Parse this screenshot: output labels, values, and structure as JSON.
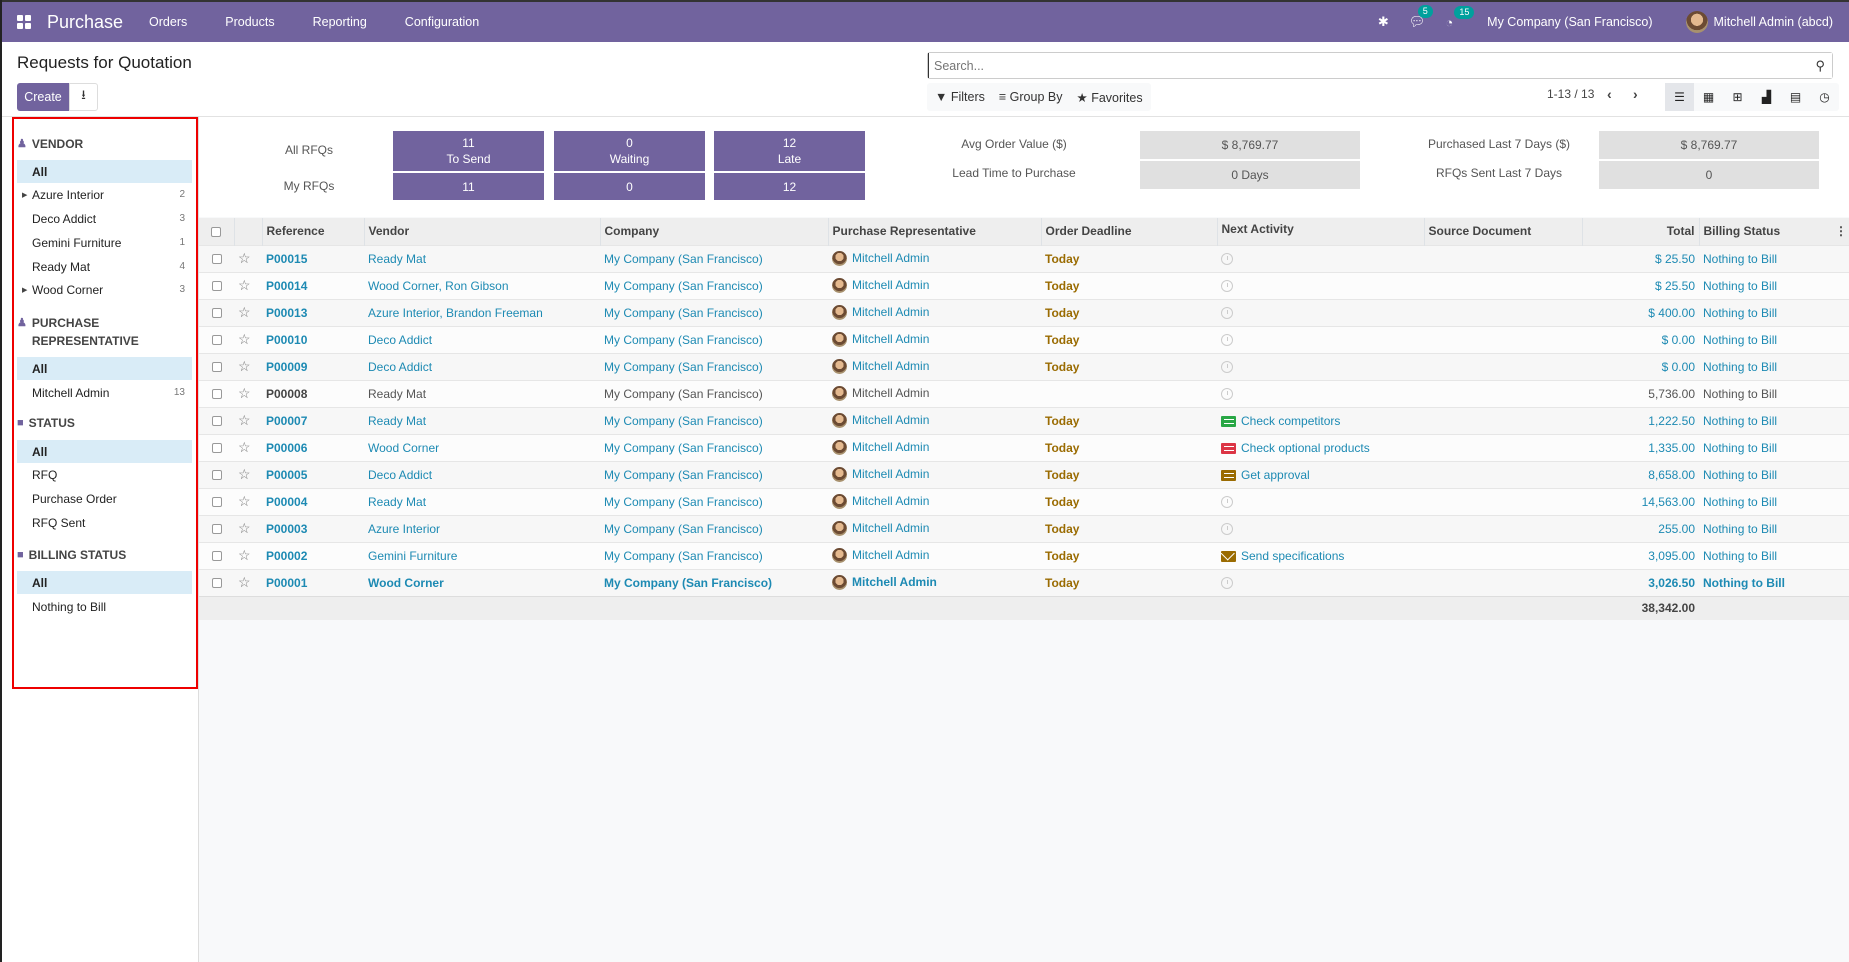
{
  "navbar": {
    "app_name": "Purchase",
    "menu": [
      "Orders",
      "Products",
      "Reporting",
      "Configuration"
    ],
    "messages_badge": "5",
    "activities_badge": "15",
    "company": "My Company (San Francisco)",
    "user": "Mitchell Admin (abcd)"
  },
  "control_panel": {
    "title": "Requests for Quotation",
    "create_label": "Create",
    "search_placeholder": "Search...",
    "filters_label": "Filters",
    "group_by_label": "Group By",
    "favorites_label": "Favorites",
    "pager": "1-13 / 13",
    "views": [
      "list",
      "kanban",
      "pivot",
      "graph",
      "calendar",
      "activity"
    ],
    "active_view": "list"
  },
  "sidebar": {
    "sections": [
      {
        "title": "VENDOR",
        "icon": "user-icon",
        "items": [
          {
            "label": "All",
            "count": "",
            "active": true,
            "expandable": false
          },
          {
            "label": "Azure Interior",
            "count": "2",
            "active": false,
            "expandable": true
          },
          {
            "label": "Deco Addict",
            "count": "3",
            "active": false,
            "expandable": false
          },
          {
            "label": "Gemini Furniture",
            "count": "1",
            "active": false,
            "expandable": false
          },
          {
            "label": "Ready Mat",
            "count": "4",
            "active": false,
            "expandable": false
          },
          {
            "label": "Wood Corner",
            "count": "3",
            "active": false,
            "expandable": true
          }
        ]
      },
      {
        "title": "PURCHASE REPRESENTATIVE",
        "icon": "user-icon",
        "items": [
          {
            "label": "All",
            "count": "",
            "active": true
          },
          {
            "label": "Mitchell Admin",
            "count": "13",
            "active": false
          }
        ]
      },
      {
        "title": "STATUS",
        "icon": "folder-icon",
        "items": [
          {
            "label": "All",
            "count": "",
            "active": true
          },
          {
            "label": "RFQ",
            "count": "",
            "active": false
          },
          {
            "label": "Purchase Order",
            "count": "",
            "active": false
          },
          {
            "label": "RFQ Sent",
            "count": "",
            "active": false
          }
        ]
      },
      {
        "title": "BILLING STATUS",
        "icon": "folder-icon",
        "items": [
          {
            "label": "All",
            "count": "",
            "active": true
          },
          {
            "label": "Nothing to Bill",
            "count": "",
            "active": false
          }
        ]
      }
    ]
  },
  "dashboard": {
    "row_labels": [
      "All RFQs",
      "My RFQs"
    ],
    "all": [
      {
        "value": "11",
        "label": "To Send"
      },
      {
        "value": "0",
        "label": "Waiting"
      },
      {
        "value": "12",
        "label": "Late"
      }
    ],
    "mine": [
      "11",
      "0",
      "12"
    ],
    "kpis": [
      {
        "label": "Avg Order Value ($)",
        "value": "$ 8,769.77"
      },
      {
        "label": "Lead Time to Purchase",
        "value": "0  Days"
      },
      {
        "label": "Purchased Last 7 Days ($)",
        "value": "$ 8,769.77"
      },
      {
        "label": "RFQs Sent Last 7 Days",
        "value": "0"
      }
    ]
  },
  "table": {
    "columns": [
      "Reference",
      "Vendor",
      "Company",
      "Purchase Representative",
      "Order Deadline",
      "Next Activity",
      "Source Document",
      "Total",
      "Billing Status"
    ],
    "rows": [
      {
        "ref": "P00015",
        "vendor": "Ready Mat",
        "company": "My Company (San Francisco)",
        "rep": "Mitchell Admin",
        "deadline": "Today",
        "activity": "",
        "activity_type": "none",
        "source": "",
        "total": "$ 25.50",
        "billing": "Nothing to Bill",
        "style": "normal"
      },
      {
        "ref": "P00014",
        "vendor": "Wood Corner, Ron Gibson",
        "company": "My Company (San Francisco)",
        "rep": "Mitchell Admin",
        "deadline": "Today",
        "activity": "",
        "activity_type": "none",
        "source": "",
        "total": "$ 25.50",
        "billing": "Nothing to Bill",
        "style": "normal"
      },
      {
        "ref": "P00013",
        "vendor": "Azure Interior, Brandon Freeman",
        "company": "My Company (San Francisco)",
        "rep": "Mitchell Admin",
        "deadline": "Today",
        "activity": "",
        "activity_type": "none",
        "source": "",
        "total": "$ 400.00",
        "billing": "Nothing to Bill",
        "style": "normal"
      },
      {
        "ref": "P00010",
        "vendor": "Deco Addict",
        "company": "My Company (San Francisco)",
        "rep": "Mitchell Admin",
        "deadline": "Today",
        "activity": "",
        "activity_type": "none",
        "source": "",
        "total": "$ 0.00",
        "billing": "Nothing to Bill",
        "style": "normal"
      },
      {
        "ref": "P00009",
        "vendor": "Deco Addict",
        "company": "My Company (San Francisco)",
        "rep": "Mitchell Admin",
        "deadline": "Today",
        "activity": "",
        "activity_type": "none",
        "source": "",
        "total": "$ 0.00",
        "billing": "Nothing to Bill",
        "style": "normal"
      },
      {
        "ref": "P00008",
        "vendor": "Ready Mat",
        "company": "My Company (San Francisco)",
        "rep": "Mitchell Admin",
        "deadline": "",
        "activity": "",
        "activity_type": "none",
        "source": "",
        "total": "5,736.00",
        "billing": "Nothing to Bill",
        "style": "muted"
      },
      {
        "ref": "P00007",
        "vendor": "Ready Mat",
        "company": "My Company (San Francisco)",
        "rep": "Mitchell Admin",
        "deadline": "Today",
        "activity": "Check competitors",
        "activity_type": "green",
        "source": "",
        "total": "1,222.50",
        "billing": "Nothing to Bill",
        "style": "normal"
      },
      {
        "ref": "P00006",
        "vendor": "Wood Corner",
        "company": "My Company (San Francisco)",
        "rep": "Mitchell Admin",
        "deadline": "Today",
        "activity": "Check optional products",
        "activity_type": "red",
        "source": "",
        "total": "1,335.00",
        "billing": "Nothing to Bill",
        "style": "normal"
      },
      {
        "ref": "P00005",
        "vendor": "Deco Addict",
        "company": "My Company (San Francisco)",
        "rep": "Mitchell Admin",
        "deadline": "Today",
        "activity": "Get approval",
        "activity_type": "orange",
        "source": "",
        "total": "8,658.00",
        "billing": "Nothing to Bill",
        "style": "normal"
      },
      {
        "ref": "P00004",
        "vendor": "Ready Mat",
        "company": "My Company (San Francisco)",
        "rep": "Mitchell Admin",
        "deadline": "Today",
        "activity": "",
        "activity_type": "none",
        "source": "",
        "total": "14,563.00",
        "billing": "Nothing to Bill",
        "style": "normal"
      },
      {
        "ref": "P00003",
        "vendor": "Azure Interior",
        "company": "My Company (San Francisco)",
        "rep": "Mitchell Admin",
        "deadline": "Today",
        "activity": "",
        "activity_type": "none",
        "source": "",
        "total": "255.00",
        "billing": "Nothing to Bill",
        "style": "normal"
      },
      {
        "ref": "P00002",
        "vendor": "Gemini Furniture",
        "company": "My Company (San Francisco)",
        "rep": "Mitchell Admin",
        "deadline": "Today",
        "activity": "Send specifications",
        "activity_type": "mail",
        "source": "",
        "total": "3,095.00",
        "billing": "Nothing to Bill",
        "style": "normal"
      },
      {
        "ref": "P00001",
        "vendor": "Wood Corner",
        "company": "My Company (San Francisco)",
        "rep": "Mitchell Admin",
        "deadline": "Today",
        "activity": "",
        "activity_type": "none",
        "source": "",
        "total": "3,026.50",
        "billing": "Nothing to Bill",
        "style": "bold"
      }
    ],
    "grand_total": "38,342.00"
  },
  "colors": {
    "brand": "#71639e",
    "link": "#1d8ab3",
    "deadline": "#9a6b01",
    "activity_green": "#28a745",
    "activity_red": "#dc3545",
    "activity_orange": "#9a6b01",
    "highlight": "#e00000"
  }
}
